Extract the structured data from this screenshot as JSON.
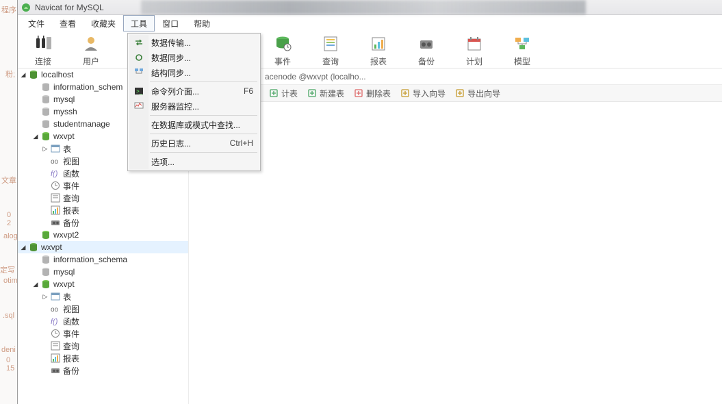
{
  "title": "Navicat for MySQL",
  "menubar": [
    "文件",
    "查看",
    "收藏夹",
    "工具",
    "窗口",
    "帮助"
  ],
  "menubar_active": 3,
  "toolbar": [
    {
      "label": "连接",
      "icon": "plug-icon"
    },
    {
      "label": "用户",
      "icon": "user-icon"
    },
    {
      "label": "",
      "icon": "",
      "hidden": true
    },
    {
      "label": "",
      "icon": "",
      "hidden": true
    },
    {
      "label": "",
      "icon": "",
      "hidden": true
    },
    {
      "label": "事件",
      "icon": "event-icon"
    },
    {
      "label": "查询",
      "icon": "query-icon"
    },
    {
      "label": "报表",
      "icon": "report-icon"
    },
    {
      "label": "备份",
      "icon": "backup-icon"
    },
    {
      "label": "计划",
      "icon": "schedule-icon"
    },
    {
      "label": "模型",
      "icon": "model-icon"
    }
  ],
  "breadcrumb_hidden": "",
  "breadcrumb_visible": "acenode @wxvpt (localho...",
  "actionbar": [
    {
      "label": "计表",
      "icon": "design-icon",
      "color": "#4aa564"
    },
    {
      "label": "新建表",
      "icon": "new-icon",
      "color": "#4aa564"
    },
    {
      "label": "删除表",
      "icon": "delete-icon",
      "color": "#d66"
    },
    {
      "label": "导入向导",
      "icon": "import-icon",
      "color": "#c59a2c"
    },
    {
      "label": "导出向导",
      "icon": "export-icon",
      "color": "#c59a2c"
    }
  ],
  "dropdown": {
    "groups": [
      [
        {
          "label": "数据传输...",
          "icon": "transfer-icon"
        },
        {
          "label": "数据同步...",
          "icon": "sync-icon"
        },
        {
          "label": "结构同步...",
          "icon": "struct-sync-icon"
        }
      ],
      [
        {
          "label": "命令列介面...",
          "shortcut": "F6",
          "icon": "cli-icon"
        },
        {
          "label": "服务器监控...",
          "icon": "monitor-icon"
        }
      ],
      [
        {
          "label": "在数据库或模式中查找..."
        }
      ],
      [
        {
          "label": "历史日志...",
          "shortcut": "Ctrl+H"
        }
      ],
      [
        {
          "label": "选项..."
        }
      ]
    ]
  },
  "tree": [
    {
      "ind": 0,
      "arrow": "down",
      "icon": "server-icon",
      "label": "localhost"
    },
    {
      "ind": 1,
      "arrow": "none",
      "icon": "db-icon",
      "label": "information_schem"
    },
    {
      "ind": 1,
      "arrow": "none",
      "icon": "db-icon",
      "label": "mysql"
    },
    {
      "ind": 1,
      "arrow": "none",
      "icon": "db-icon",
      "label": "myssh"
    },
    {
      "ind": 1,
      "arrow": "none",
      "icon": "db-icon",
      "label": "studentmanage"
    },
    {
      "ind": 1,
      "arrow": "down",
      "icon": "db-open-icon",
      "label": "wxvpt"
    },
    {
      "ind": 2,
      "arrow": "right",
      "icon": "table-icon",
      "label": "表"
    },
    {
      "ind": 2,
      "arrow": "none",
      "icon": "view-icon",
      "label": "视图"
    },
    {
      "ind": 2,
      "arrow": "none",
      "icon": "func-icon",
      "label": "函数"
    },
    {
      "ind": 2,
      "arrow": "none",
      "icon": "event-small-icon",
      "label": "事件"
    },
    {
      "ind": 2,
      "arrow": "none",
      "icon": "query-small-icon",
      "label": "查询"
    },
    {
      "ind": 2,
      "arrow": "none",
      "icon": "report-small-icon",
      "label": "报表"
    },
    {
      "ind": 2,
      "arrow": "none",
      "icon": "backup-small-icon",
      "label": "备份"
    },
    {
      "ind": 1,
      "arrow": "none",
      "icon": "db-open-icon",
      "label": "wxvpt2"
    },
    {
      "ind": 0,
      "arrow": "down",
      "icon": "server-icon",
      "label": "wxvpt",
      "sel": true
    },
    {
      "ind": 1,
      "arrow": "none",
      "icon": "db-icon",
      "label": "information_schema"
    },
    {
      "ind": 1,
      "arrow": "none",
      "icon": "db-icon",
      "label": "mysql"
    },
    {
      "ind": 1,
      "arrow": "down",
      "icon": "db-open-icon",
      "label": "wxvpt"
    },
    {
      "ind": 2,
      "arrow": "right",
      "icon": "table-icon",
      "label": "表"
    },
    {
      "ind": 2,
      "arrow": "none",
      "icon": "view-icon",
      "label": "视图"
    },
    {
      "ind": 2,
      "arrow": "none",
      "icon": "func-icon",
      "label": "函数"
    },
    {
      "ind": 2,
      "arrow": "none",
      "icon": "event-small-icon",
      "label": "事件"
    },
    {
      "ind": 2,
      "arrow": "none",
      "icon": "query-small-icon",
      "label": "查询"
    },
    {
      "ind": 2,
      "arrow": "none",
      "icon": "report-small-icon",
      "label": "报表"
    },
    {
      "ind": 2,
      "arrow": "none",
      "icon": "backup-small-icon",
      "label": "备份"
    }
  ],
  "gutter": [
    "程序",
    "粉;",
    "文章",
    "0 2",
    "alog",
    "定写",
    "otim",
    "",
    ".sql",
    "deni",
    "0 15"
  ]
}
